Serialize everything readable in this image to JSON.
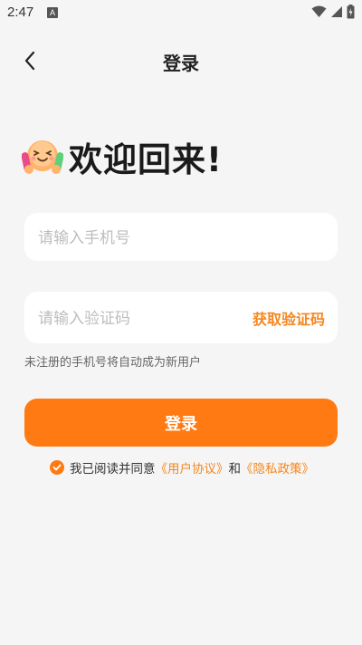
{
  "status_bar": {
    "time": "2:47",
    "notification_badge": "A",
    "icons": [
      "wifi-icon",
      "signal-icon",
      "battery-charging-icon"
    ]
  },
  "header": {
    "title": "登录",
    "back_icon": "chevron-left-icon"
  },
  "welcome": {
    "text": "欢迎回来!",
    "emoji": "hugging-face-emoji"
  },
  "form": {
    "phone_placeholder": "请输入手机号",
    "code_placeholder": "请输入验证码",
    "get_code_label": "获取验证码",
    "hint": "未注册的手机号将自动成为新用户",
    "login_label": "登录"
  },
  "agreement": {
    "checked": true,
    "prefix": "我已阅读并同意",
    "user_agreement": "《用户协议》",
    "and": "和",
    "privacy_policy": "《隐私政策》"
  },
  "colors": {
    "accent": "#ff7a12",
    "link": "#f5861f",
    "background": "#f5f5f5"
  }
}
